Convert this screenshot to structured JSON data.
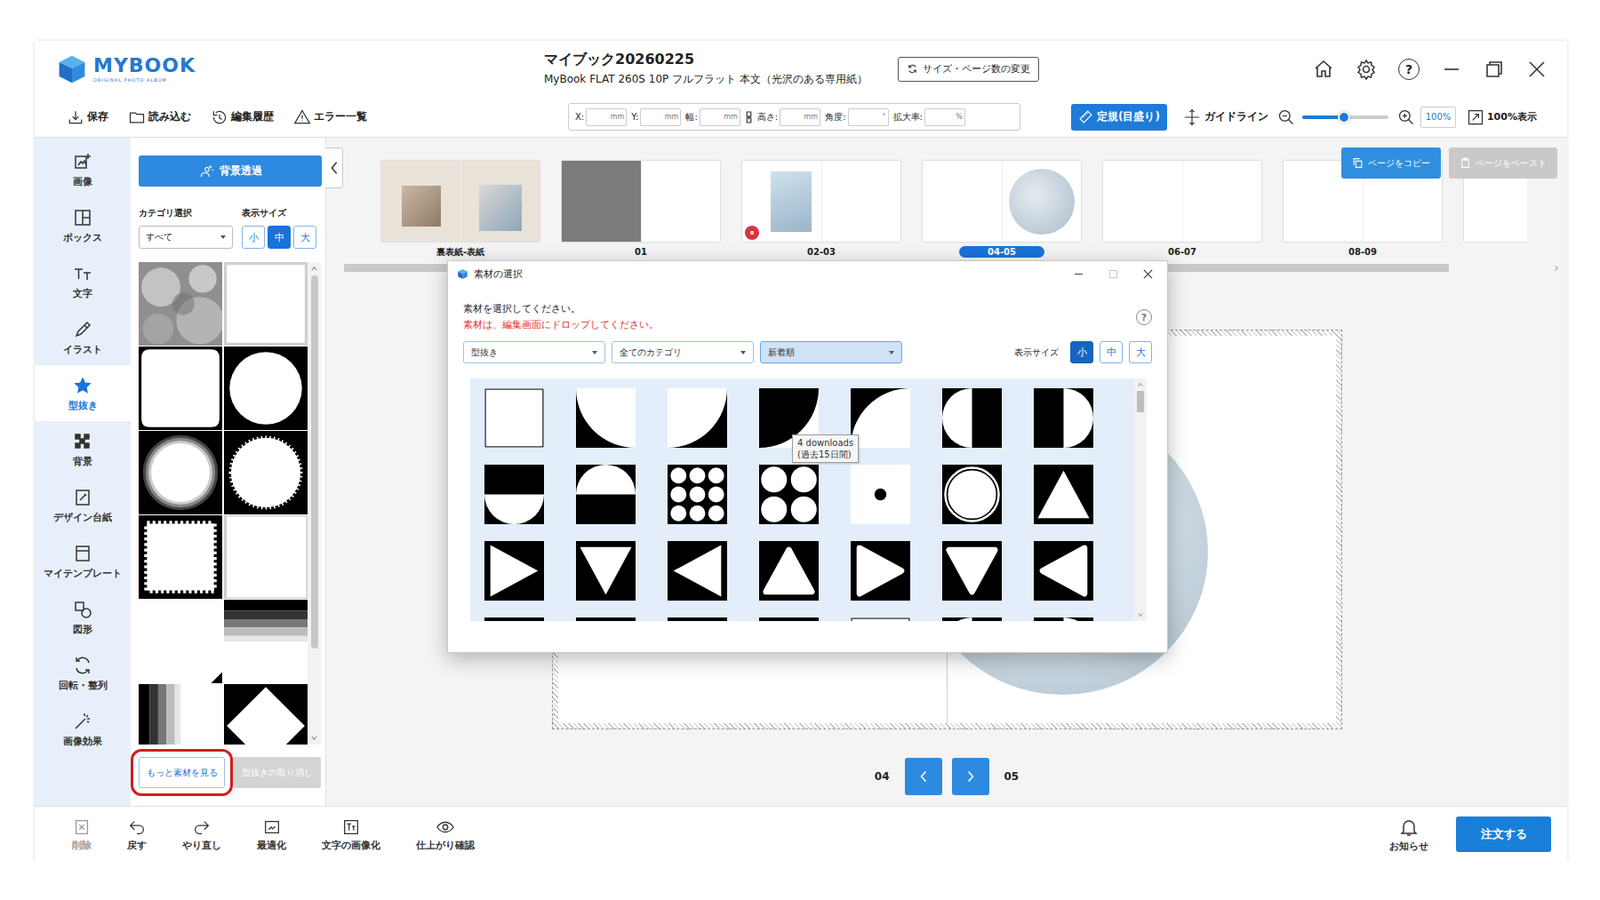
{
  "titlebar": {
    "logo": "MYBOOK",
    "logo_sub": "ORIGINAL PHOTO ALBUM",
    "title": "マイブック20260225",
    "subtitle": "MyBook FLAT 260S 10P フルフラット 本文（光沢のある専用紙）",
    "resize_button": "サイズ・ページ数の変更",
    "help": "?"
  },
  "toolbar": {
    "actions": [
      "保存",
      "読み込む",
      "編集履歴",
      "エラー一覧"
    ],
    "fields": [
      {
        "label": "X:",
        "unit": "mm"
      },
      {
        "label": "Y:",
        "unit": "mm"
      },
      {
        "label": "幅:",
        "unit": "mm"
      },
      {
        "label": "高さ:",
        "unit": "mm"
      },
      {
        "label": "角度:",
        "unit": "°"
      },
      {
        "label": "拡大率:",
        "unit": "%"
      }
    ],
    "ruler": {
      "label": "定規(目盛り)",
      "on": true
    },
    "guide": "ガイドライン",
    "zoom": {
      "level": 0.48,
      "value": "100%"
    },
    "fit": "100%表示"
  },
  "sidebar": {
    "items": [
      {
        "label": "画像",
        "selected": false
      },
      {
        "label": "ボックス",
        "selected": false
      },
      {
        "label": "文字",
        "selected": false
      },
      {
        "label": "イラスト",
        "selected": false
      },
      {
        "label": "型抜き",
        "selected": true
      },
      {
        "label": "背景",
        "selected": false
      },
      {
        "label": "デザイン台紙",
        "selected": false
      },
      {
        "label": "マイテンプレート",
        "selected": false
      },
      {
        "label": "図形",
        "selected": false
      },
      {
        "label": "回転・整列",
        "selected": false
      },
      {
        "label": "画像効果",
        "selected": false
      }
    ]
  },
  "panel": {
    "bg_button": "背景透過",
    "category_label": "カテゴリ選択",
    "category": "すべて",
    "size_label": "表示サイズ",
    "sizes": [
      {
        "label": "小",
        "selected": false
      },
      {
        "label": "中",
        "selected": true
      },
      {
        "label": "大",
        "selected": false
      }
    ],
    "shapes": [
      {
        "kind": "cloud"
      },
      {
        "kind": "square-white"
      },
      {
        "kind": "rounded-square"
      },
      {
        "kind": "circle"
      },
      {
        "kind": "soft-circle"
      },
      {
        "kind": "rough-circle"
      },
      {
        "kind": "stamp"
      },
      {
        "kind": "square-thin"
      },
      {
        "kind": "square-cut"
      },
      {
        "kind": "fade-top"
      },
      {
        "kind": "fade-left"
      },
      {
        "kind": "diamond"
      }
    ],
    "more_button": {
      "label": "もっと素材を見る",
      "highlighted": true
    },
    "cancel_button": {
      "label": "型抜きの取り消し",
      "disabled": true
    }
  },
  "pages": {
    "thumbnails": [
      {
        "label": "裏表紙-表紙",
        "kind": "cover",
        "selected": false
      },
      {
        "label": "01",
        "kind": "grey-left",
        "selected": false
      },
      {
        "label": "02-03",
        "kind": "photo-left",
        "selected": false
      },
      {
        "label": "04-05",
        "kind": "circle-right",
        "selected": true
      },
      {
        "label": "06-07",
        "kind": "blank",
        "selected": false
      },
      {
        "label": "08-09",
        "kind": "blank",
        "selected": false
      },
      {
        "kind": "blank",
        "selected": false
      }
    ],
    "copy": {
      "label": "ページをコピー",
      "disabled": false
    },
    "paste": {
      "label": "ページをペースト",
      "disabled": true
    },
    "nav": {
      "left": "04",
      "right": "05"
    }
  },
  "bottom_bar": {
    "items": [
      {
        "label": "削除",
        "disabled": true
      },
      {
        "label": "戻す",
        "disabled": false
      },
      {
        "label": "やり直し",
        "disabled": false
      },
      {
        "label": "最適化",
        "disabled": false
      },
      {
        "label": "文字の画像化",
        "disabled": false
      },
      {
        "label": "仕上がり確認",
        "disabled": false
      }
    ],
    "notice": "お知らせ",
    "order": "注文する"
  },
  "dialog": {
    "title": "素材の選択",
    "instruction": "素材を選択してください。",
    "note": "素材は、編集画面にドロップしてください。",
    "help": "?",
    "filters": [
      {
        "value": "型抜き",
        "selected": false
      },
      {
        "value": "全てのカテゴリ",
        "selected": false
      },
      {
        "value": "新着順",
        "selected": true
      }
    ],
    "size_label": "表示サイズ",
    "sizes": [
      {
        "label": "小",
        "selected": true
      },
      {
        "label": "中",
        "selected": false
      },
      {
        "label": "大",
        "selected": false
      }
    ],
    "materials": [
      {
        "kind": "square-outline",
        "hovered": false
      },
      {
        "kind": "quarter-a",
        "hovered": false
      },
      {
        "kind": "quarter-b",
        "hovered": false
      },
      {
        "kind": "quarter-c",
        "hovered": true
      },
      {
        "kind": "quarter-d",
        "hovered": false
      },
      {
        "kind": "half-left",
        "hovered": false
      },
      {
        "kind": "half-right",
        "hovered": false
      },
      {
        "kind": "half-top",
        "hovered": false
      },
      {
        "kind": "half-bottom",
        "hovered": false
      },
      {
        "kind": "dots-9",
        "hovered": false
      },
      {
        "kind": "dots-4",
        "hovered": false
      },
      {
        "kind": "dot",
        "hovered": false
      },
      {
        "kind": "ring",
        "hovered": false
      },
      {
        "kind": "tri-up",
        "hovered": false
      },
      {
        "kind": "tri-right",
        "hovered": false
      },
      {
        "kind": "tri-down",
        "hovered": false
      },
      {
        "kind": "tri-left",
        "hovered": false
      },
      {
        "kind": "round-up",
        "hovered": false
      },
      {
        "kind": "round-right",
        "hovered": false
      },
      {
        "kind": "round-down",
        "hovered": false
      },
      {
        "kind": "round-left",
        "hovered": false
      },
      {
        "kind": "tri-up",
        "hovered": false
      },
      {
        "kind": "tri-right",
        "hovered": false
      },
      {
        "kind": "tri-down",
        "hovered": false
      },
      {
        "kind": "tri-left",
        "hovered": false
      },
      {
        "kind": "square-outline",
        "hovered": false
      },
      {
        "kind": "half-left",
        "hovered": false
      },
      {
        "kind": "half-right",
        "hovered": false
      }
    ],
    "tooltip": [
      "4 downloads",
      "(過去15日間)"
    ]
  }
}
